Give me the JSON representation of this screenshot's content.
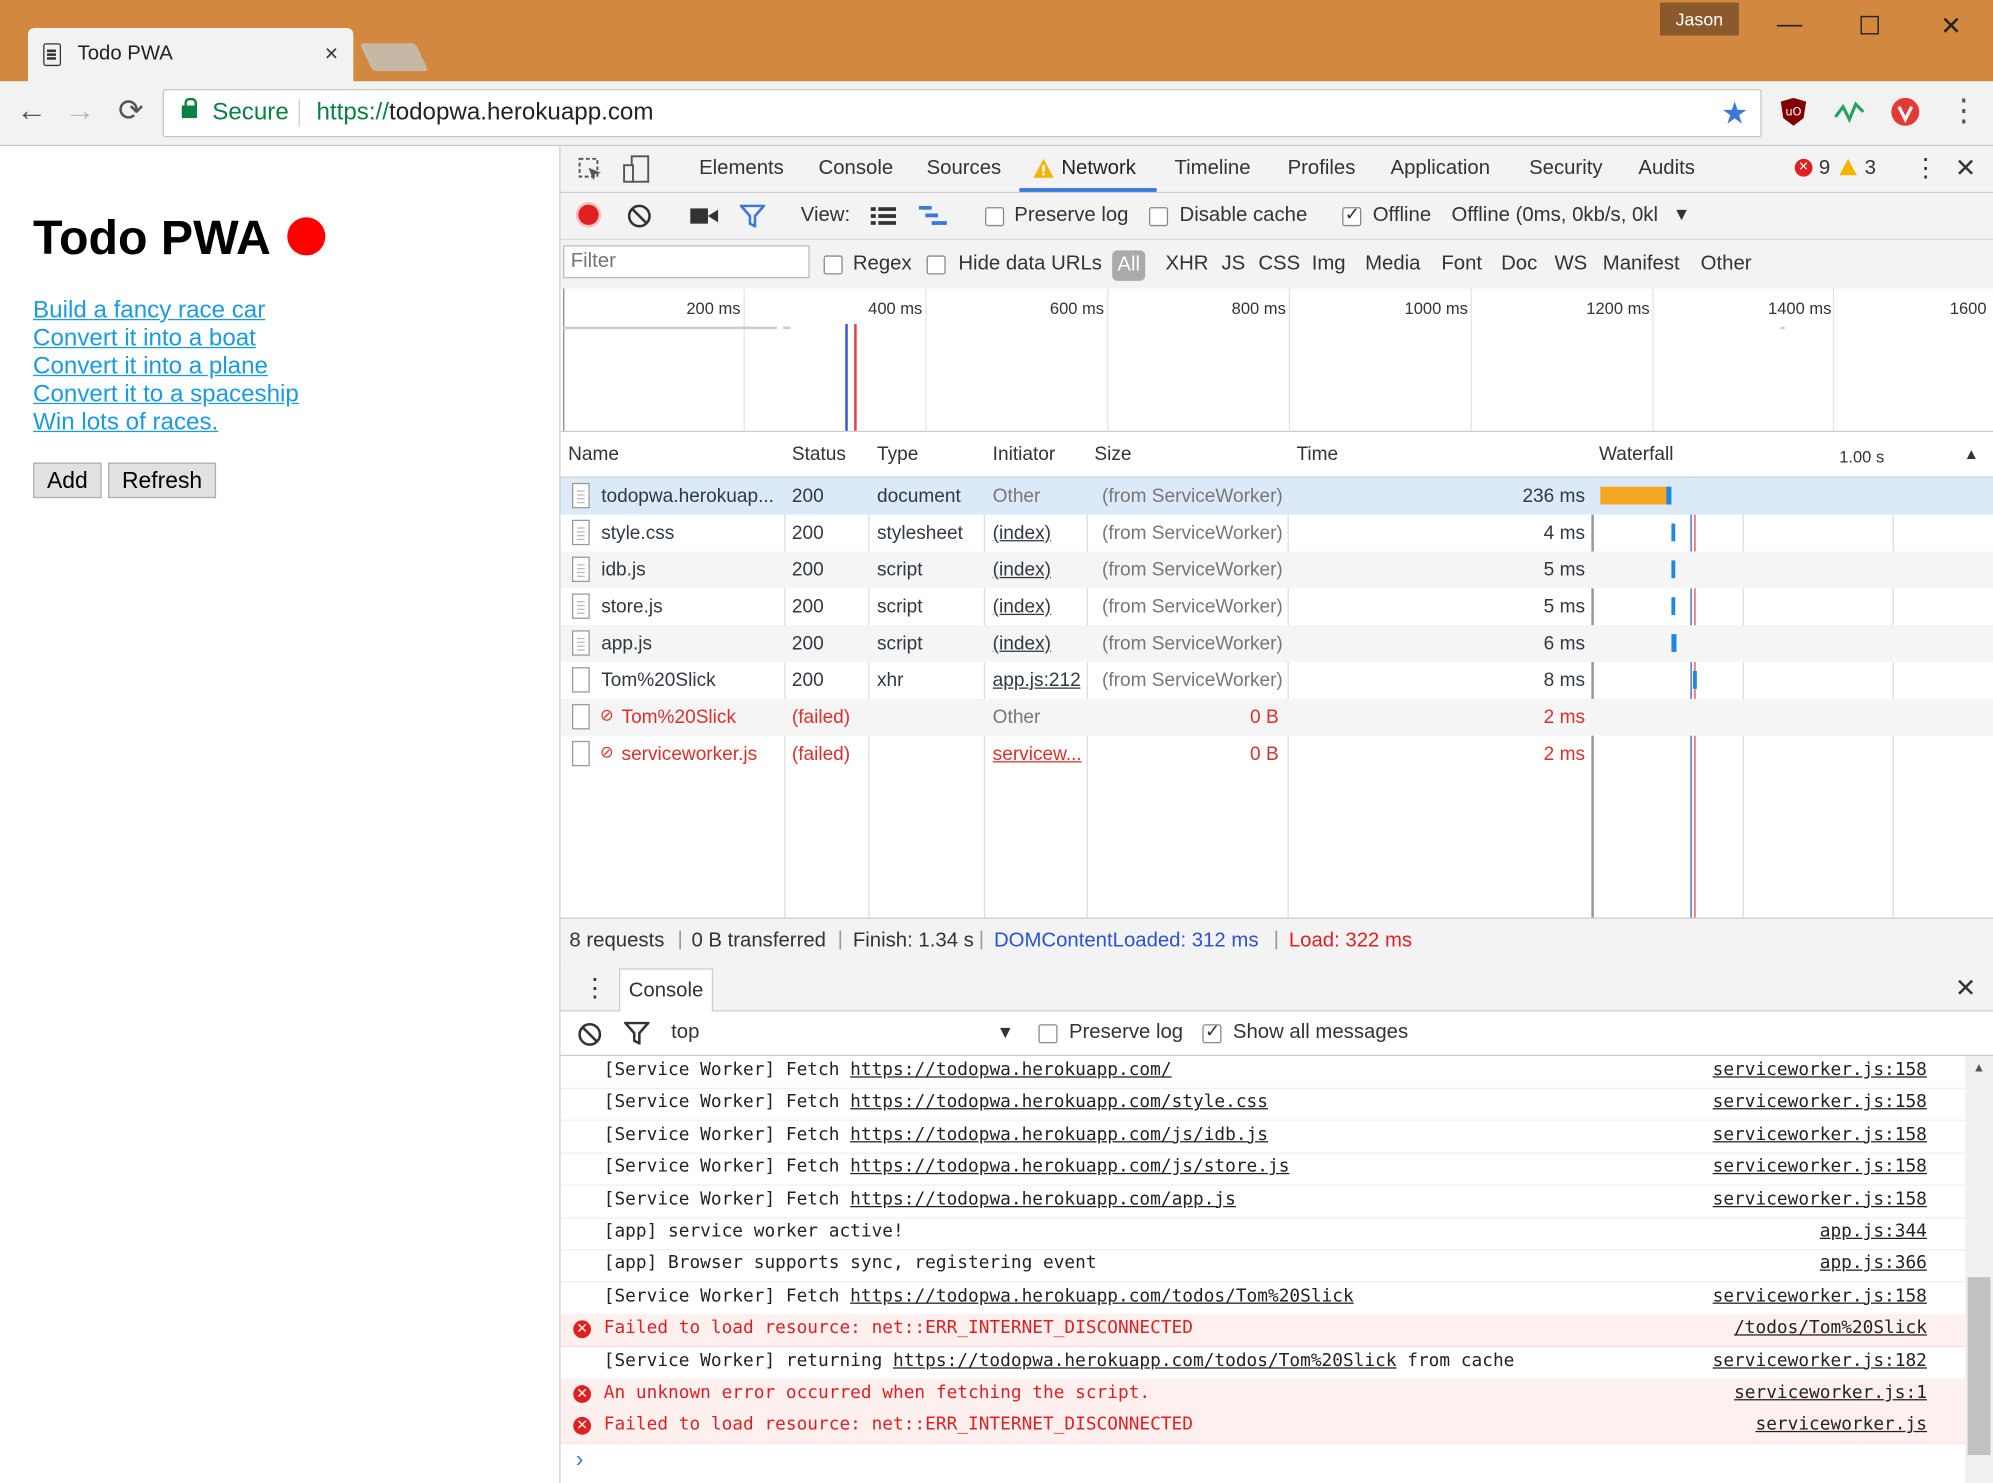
{
  "window": {
    "tab_title": "Todo PWA",
    "tab_close": "×",
    "profile_name": "Jason",
    "minimize": "—",
    "maximize": "☐",
    "close": "✕"
  },
  "toolbar": {
    "back": "←",
    "forward": "→",
    "reload": "⟳",
    "secure_label": "Secure",
    "url_scheme": "https://",
    "url_host": "todopwa.herokuapp.com",
    "star": "★",
    "menu": "⋮"
  },
  "page": {
    "title": "Todo PWA",
    "status_color": "#ff0000",
    "todos": [
      "Build a fancy race car",
      "Convert it into a boat",
      "Convert it into a plane",
      "Convert it to a spaceship",
      "Win lots of races."
    ],
    "add_label": "Add",
    "refresh_label": "Refresh"
  },
  "devtools": {
    "tabs": [
      "Elements",
      "Console",
      "Sources",
      "Network",
      "Timeline",
      "Profiles",
      "Application",
      "Security",
      "Audits"
    ],
    "active_tab": "Network",
    "error_count": "9",
    "warning_count": "3",
    "toolbar": {
      "view_label": "View:",
      "preserve_log": "Preserve log",
      "disable_cache": "Disable cache",
      "offline_label": "Offline",
      "throttle": "Offline (0ms, 0kb/s, 0kl"
    },
    "filterbar": {
      "filter_placeholder": "Filter",
      "regex": "Regex",
      "hide_data_urls": "Hide data URLs",
      "types": [
        "All",
        "XHR",
        "JS",
        "CSS",
        "Img",
        "Media",
        "Font",
        "Doc",
        "WS",
        "Manifest",
        "Other"
      ]
    },
    "overview_ticks": [
      "200 ms",
      "400 ms",
      "600 ms",
      "800 ms",
      "1000 ms",
      "1200 ms",
      "1400 ms",
      "1600"
    ],
    "columns": {
      "name": "Name",
      "status": "Status",
      "type": "Type",
      "initiator": "Initiator",
      "size": "Size",
      "time": "Time",
      "waterfall": "Waterfall",
      "waterfall_scale": "1.00 s"
    },
    "requests": [
      {
        "name": "todopwa.herokuap...",
        "status": "200",
        "type": "document",
        "initiator": "Other",
        "size": "(from ServiceWorker)",
        "time": "236 ms"
      },
      {
        "name": "style.css",
        "status": "200",
        "type": "stylesheet",
        "initiator": "(index)",
        "size": "(from ServiceWorker)",
        "time": "4 ms"
      },
      {
        "name": "idb.js",
        "status": "200",
        "type": "script",
        "initiator": "(index)",
        "size": "(from ServiceWorker)",
        "time": "5 ms"
      },
      {
        "name": "store.js",
        "status": "200",
        "type": "script",
        "initiator": "(index)",
        "size": "(from ServiceWorker)",
        "time": "5 ms"
      },
      {
        "name": "app.js",
        "status": "200",
        "type": "script",
        "initiator": "(index)",
        "size": "(from ServiceWorker)",
        "time": "6 ms"
      },
      {
        "name": "Tom%20Slick",
        "status": "200",
        "type": "xhr",
        "initiator": "app.js:212",
        "size": "(from ServiceWorker)",
        "time": "8 ms"
      },
      {
        "name": "Tom%20Slick",
        "status": "(failed)",
        "type": "",
        "initiator": "Other",
        "size": "0 B",
        "time": "2 ms"
      },
      {
        "name": "serviceworker.js",
        "status": "(failed)",
        "type": "",
        "initiator": "servicew...",
        "size": "0 B",
        "time": "2 ms"
      }
    ],
    "summary": {
      "requests": "8 requests",
      "transferred": "0 B transferred",
      "finish": "Finish: 1.34 s",
      "dcl": "DOMContentLoaded: 312 ms",
      "load": "Load: 322 ms"
    },
    "drawer": {
      "console_tab": "Console",
      "context": "top",
      "preserve_log": "Preserve log",
      "show_all": "Show all messages"
    },
    "console_lines": [
      {
        "pre": "[Service Worker] Fetch ",
        "link": "https://todopwa.herokuapp.com/",
        "post": "",
        "src": "serviceworker.js:158",
        "error": false
      },
      {
        "pre": "[Service Worker] Fetch ",
        "link": "https://todopwa.herokuapp.com/style.css",
        "post": "",
        "src": "serviceworker.js:158",
        "error": false
      },
      {
        "pre": "[Service Worker] Fetch ",
        "link": "https://todopwa.herokuapp.com/js/idb.js",
        "post": "",
        "src": "serviceworker.js:158",
        "error": false
      },
      {
        "pre": "[Service Worker] Fetch ",
        "link": "https://todopwa.herokuapp.com/js/store.js",
        "post": "",
        "src": "serviceworker.js:158",
        "error": false
      },
      {
        "pre": "[Service Worker] Fetch ",
        "link": "https://todopwa.herokuapp.com/app.js",
        "post": "",
        "src": "serviceworker.js:158",
        "error": false
      },
      {
        "pre": "[app] service worker active!",
        "link": "",
        "post": "",
        "src": "app.js:344",
        "error": false
      },
      {
        "pre": "[app] Browser supports sync, registering event",
        "link": "",
        "post": "",
        "src": "app.js:366",
        "error": false
      },
      {
        "pre": "[Service Worker] Fetch ",
        "link": "https://todopwa.herokuapp.com/todos/Tom%20Slick",
        "post": "",
        "src": "serviceworker.js:158",
        "error": false
      },
      {
        "pre": "Failed to load resource: net::ERR_INTERNET_DISCONNECTED",
        "link": "",
        "post": "",
        "src": "/todos/Tom%20Slick",
        "error": true
      },
      {
        "pre": "[Service Worker] returning ",
        "link": "https://todopwa.herokuapp.com/todos/Tom%20Slick",
        "post": " from cache",
        "src": "serviceworker.js:182",
        "error": false
      },
      {
        "pre": "An unknown error occurred when fetching the script.",
        "link": "",
        "post": "",
        "src": "serviceworker.js:1",
        "error": true
      },
      {
        "pre": "Failed to load resource: net::ERR_INTERNET_DISCONNECTED",
        "link": "",
        "post": "",
        "src": "serviceworker.js",
        "error": true
      }
    ],
    "prompt": "›"
  },
  "colors": {
    "titlebar": "#d2883f",
    "accent_blue": "#3879d9",
    "error_red": "#d9302c",
    "waterfall_orange": "#f5a623",
    "waterfall_blue": "#1e88e5"
  }
}
